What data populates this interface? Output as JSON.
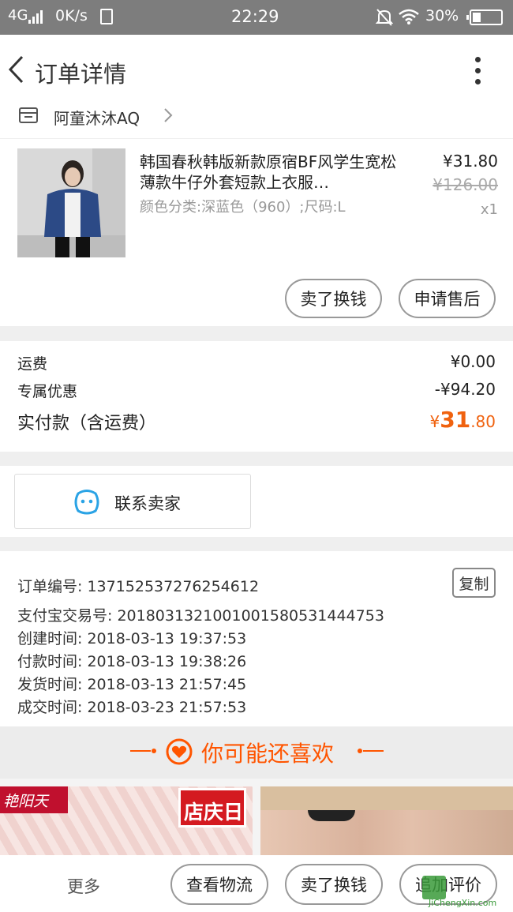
{
  "status_bar": {
    "network": "4G",
    "speed": "0K/s",
    "time": "22:29",
    "battery": "30%",
    "battery_level": 0.3
  },
  "header": {
    "title": "订单详情"
  },
  "shop": {
    "name": "阿童沐沐AQ"
  },
  "product": {
    "title": "韩国春秋韩版新款原宿BF风学生宽松薄款牛仔外套短款上衣服…",
    "sku": "颜色分类:深蓝色（960）;尺码:L",
    "price": "¥31.80",
    "original_price": "¥126.00",
    "quantity": "x1",
    "buttons": {
      "sell": "卖了换钱",
      "after_sales": "申请售后"
    }
  },
  "summary": {
    "shipping_label": "运费",
    "shipping_value": "¥0.00",
    "discount_label": "专属优惠",
    "discount_value": "-¥94.20",
    "paid_label": "实付款（含运费）",
    "paid_currency": "¥",
    "paid_int": "31",
    "paid_dec": ".80"
  },
  "contact": {
    "label": "联系卖家"
  },
  "order_info": {
    "order_no": "订单编号: 137152537276254612",
    "copy": "复制",
    "alipay_no": "支付宝交易号: 2018031321001001580531444753",
    "created": "创建时间: 2018-03-13 19:37:53",
    "paid": "付款时间: 2018-03-13 19:38:26",
    "shipped": "发货时间: 2018-03-13 21:57:45",
    "completed": "成交时间: 2018-03-23 21:57:53"
  },
  "recommend": {
    "title": "你可能还喜欢",
    "banner_brand": "艳阳天",
    "banner_promo": "店庆日"
  },
  "bottom_bar": {
    "more": "更多",
    "logistics": "查看物流",
    "sell": "卖了换钱",
    "review": "追加评价"
  },
  "watermark": {
    "site": "JiChengXin.com"
  },
  "colors": {
    "accent": "#ff5500",
    "status_bar": "#7d7d7d",
    "contact_icon": "#2aa3e5",
    "price_orange": "#f0620f"
  }
}
